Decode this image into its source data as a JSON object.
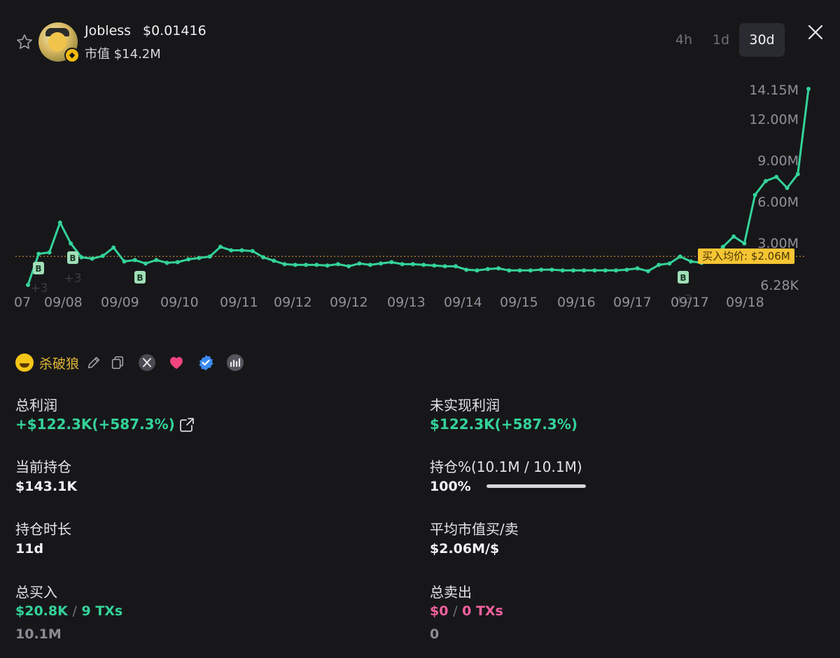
{
  "header": {
    "token_name": "Jobless",
    "token_price": "$0.01416",
    "market_cap": "市值 $14.2M",
    "timeframes": [
      "4h",
      "1d",
      "30d"
    ],
    "active_timeframe": "30d"
  },
  "chart_data": {
    "type": "line",
    "y_axis_labels": [
      "14.15M",
      "12.00M",
      "9.00M",
      "6.00M",
      "3.00M",
      "6.28K"
    ],
    "x_axis_labels": [
      "07",
      "09/08",
      "09/09",
      "09/10",
      "09/11",
      "09/12",
      "09/12",
      "09/13",
      "09/14",
      "09/15",
      "09/16",
      "09/17",
      "09/17",
      "09/18"
    ],
    "avg_buy_label": "买入均价: $2.06M",
    "avg_buy_value": 2060000,
    "buy_markers": [
      "B",
      "B",
      "B",
      "B"
    ],
    "buy_marker_counts": [
      "+3",
      "+3",
      "+3"
    ],
    "series": [
      {
        "values": [
          6280,
          2250000,
          2350000,
          4500000,
          3000000,
          2000000,
          1900000,
          2100000,
          2700000,
          1700000,
          1800000,
          1550000,
          1800000,
          1600000,
          1650000,
          1850000,
          1950000,
          2050000,
          2750000,
          2500000,
          2500000,
          2450000,
          2000000,
          1750000,
          1500000,
          1450000,
          1450000,
          1450000,
          1400000,
          1500000,
          1350000,
          1550000,
          1450000,
          1550000,
          1650000,
          1500000,
          1500000,
          1450000,
          1400000,
          1350000,
          1350000,
          1100000,
          1050000,
          1150000,
          1200000,
          1050000,
          1050000,
          1050000,
          1100000,
          1100000,
          1050000,
          1050000,
          1050000,
          1050000,
          1050000,
          1050000,
          1100000,
          1200000,
          1000000,
          1450000,
          1550000,
          2050000,
          1700000,
          1600000,
          1750000,
          2750000,
          3500000,
          3000000,
          6500000,
          7500000,
          7800000,
          7000000,
          8000000,
          14150000
        ]
      }
    ]
  },
  "user": {
    "name": "杀破狼",
    "icons": [
      "pencil-icon",
      "copy-icon",
      "x-twitter-icon",
      "heart-icon",
      "verified-icon",
      "chart-icon"
    ]
  },
  "stats": {
    "total_profit_label": "总利润",
    "total_profit_value": "+$122.3K(+587.3%)",
    "unrealized_label": "未实现利润",
    "unrealized_value": "$122.3K(+587.3%)",
    "holding_label": "当前持仓",
    "holding_value": "$143.1K",
    "position_pct_label": "持仓%(10.1M / 10.1M)",
    "position_pct_value": "100%",
    "position_fraction": 1.0,
    "duration_label": "持仓时长",
    "duration_value": "11d",
    "avg_mcap_label": "平均市值买/卖",
    "avg_mcap_value": "$2.06M/$",
    "total_buy_label": "总买入",
    "total_buy_amount": "$20.8K",
    "total_buy_sep": "/",
    "total_buy_txs": "9 TXs",
    "total_buy_tokens": "10.1M",
    "total_sell_label": "总卖出",
    "total_sell_amount": "$0",
    "total_sell_sep": "/",
    "total_sell_txs": "0 TXs",
    "total_sell_tokens": "0"
  }
}
